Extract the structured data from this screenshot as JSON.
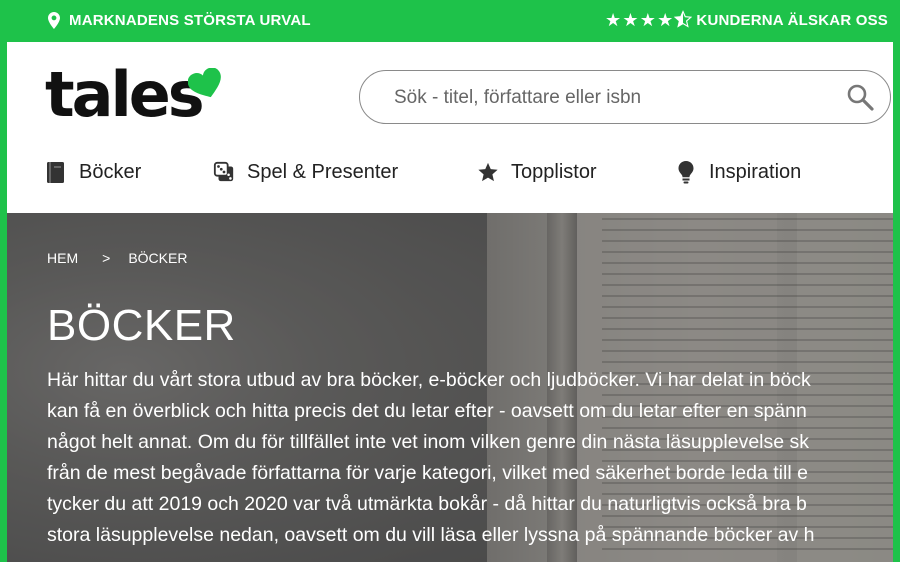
{
  "topbar": {
    "left_text": "MARKNADENS STÖRSTA URVAL",
    "right_text": "KUNDERNA ÄLSKAR OSS",
    "rating_stars": 4.5
  },
  "header": {
    "logo_text": "tales",
    "search_placeholder": "Sök - titel, författare eller isbn",
    "nav": [
      {
        "label": "Böcker",
        "icon": "book-icon"
      },
      {
        "label": "Spel & Presenter",
        "icon": "dice-icon"
      },
      {
        "label": "Topplistor",
        "icon": "star-icon"
      },
      {
        "label": "Inspiration",
        "icon": "lightbulb-icon"
      }
    ]
  },
  "hero": {
    "breadcrumb": [
      "HEM",
      "BÖCKER"
    ],
    "breadcrumb_sep": ">",
    "title": "BÖCKER",
    "description_lines": [
      "Här hittar du vårt stora utbud av bra böcker, e-böcker och ljudböcker. Vi har delat in böck",
      "kan få en överblick och hitta precis det du letar efter - oavsett om du letar efter en spänn",
      "något helt annat. Om du för tillfället inte vet inom vilken genre din nästa läsupplevelse sk",
      "från de mest begåvade författarna för varje kategori, vilket med säkerhet borde leda till e",
      "tycker du att 2019 och 2020 var två utmärkta bokår - då hittar du naturligtvis också bra b",
      "stora läsupplevelse nedan, oavsett om du vill läsa eller lyssna på spännande böcker av h"
    ]
  },
  "colors": {
    "brand_green": "#1ec24a",
    "text_dark": "#222222"
  }
}
